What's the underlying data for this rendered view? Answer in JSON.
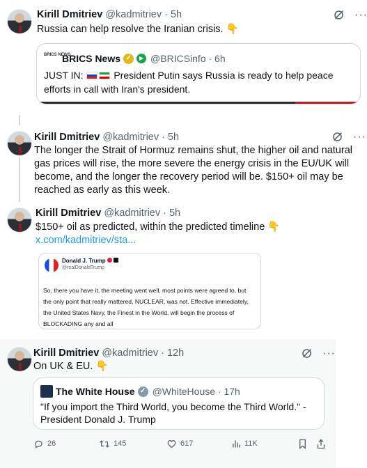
{
  "tweet1": {
    "name": "Kirill Dmitriev",
    "handle": "@kadmitriev · 5h",
    "text": "Russia can help resolve the Iranian crisis. 👇",
    "quote": {
      "logo_text": "BRICS NEWS",
      "name": "BRICS News",
      "handle": "@BRICSinfo · 6h",
      "text_prefix": "JUST IN:",
      "text_body": "President Putin says Russia is ready to help peace efforts in call with Iran's president."
    }
  },
  "tweet2": {
    "name": "Kirill Dmitriev",
    "handle": "@kadmitriev · 5h",
    "text": "The longer the Strait of Hormuz remains shut, the higher oil and natural gas prices will rise, the more severe the energy crisis in the EU/UK will become, and the longer the recovery period will be. $150+ oil may be reached as early as this week."
  },
  "tweet3": {
    "name": "Kirill Dmitriev",
    "handle": "@kadmitriev · 5h",
    "text": "$150+ oil as predicted, within the predicted timeline 👇",
    "link": "x.com/kadmitriev/sta...",
    "image": {
      "name": "Donald J. Trump",
      "handle": "@realDonaldTrump",
      "text": "So, there you have it, the meeting went well, most points were agreed to, but the only point that really mattered, NUCLEAR, was not. Effective immediately, the United States Navy, the Finest in the World, will begin the process of BLOCKADING any and all"
    }
  },
  "tweet4": {
    "name": "Kirill Dmitriev",
    "handle": "@kadmitriev · 12h",
    "text": "On UK & EU. 👇",
    "quote": {
      "name": "The White House",
      "handle": "@WhiteHouse · 17h",
      "text": "\"If you import the Third World, you become the Third World.\" - President Donald J. Trump"
    },
    "stats": {
      "replies": "26",
      "reposts": "145",
      "likes": "617",
      "views": "11K"
    }
  },
  "colors": {
    "link": "#1d9bf0",
    "secondary_text": "#536471",
    "verified_gold": "#e2b719",
    "verified_gray": "#829aab"
  }
}
